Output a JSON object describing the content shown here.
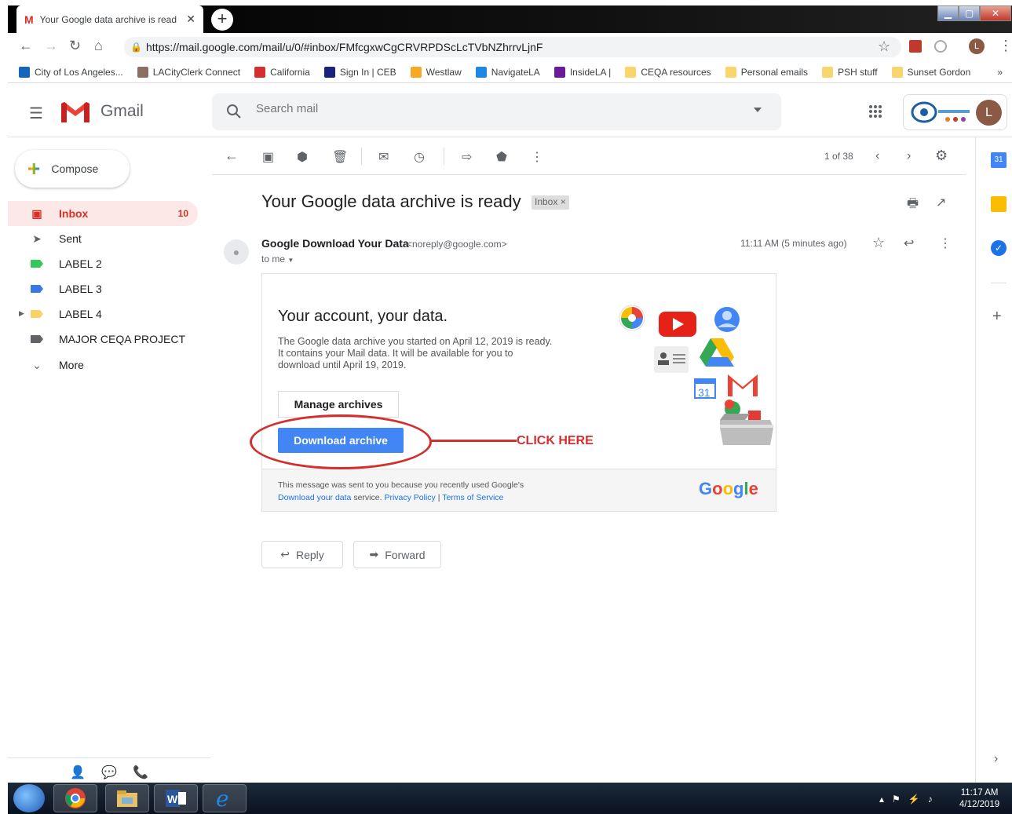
{
  "browser": {
    "tab_title": "Your Google data archive is read",
    "url": "https://mail.google.com/mail/u/0/#inbox/FMfcgxwCgCRVRPDScLcTVbNZhrrvLjnF",
    "bookmarks": [
      {
        "label": "City of Los Angeles...",
        "color": "#1565c0"
      },
      {
        "label": "LACityClerk Connect",
        "color": "#8d6e63"
      },
      {
        "label": "California",
        "color": "#d32f2f"
      },
      {
        "label": "Sign In | CEB",
        "color": "#1a237e"
      },
      {
        "label": "Westlaw",
        "color": "#f9a825"
      },
      {
        "label": "NavigateLA",
        "color": "#1e88e5"
      },
      {
        "label": "InsideLA |",
        "color": "#6a1b9a"
      },
      {
        "label": "CEQA resources",
        "color": "#f9d56e"
      },
      {
        "label": "Personal emails",
        "color": "#f9d56e"
      },
      {
        "label": "PSH stuff",
        "color": "#f9d56e"
      },
      {
        "label": "Sunset Gordon",
        "color": "#f9d56e"
      }
    ],
    "more": "»"
  },
  "gmail": {
    "app_name": "Gmail",
    "search_placeholder": "Search mail",
    "avatar_letter": "L",
    "compose_label": "Compose",
    "sidebar": [
      {
        "label": "Inbox",
        "count": "10"
      },
      {
        "label": "Sent",
        "count": ""
      },
      {
        "label": "LABEL 2",
        "count": "",
        "color": "#34c759"
      },
      {
        "label": "LABEL 3",
        "count": "",
        "color": "#3b78e7"
      },
      {
        "label": "LABEL 4",
        "count": "",
        "color": "#fad165"
      },
      {
        "label": "MAJOR CEQA PROJECT",
        "count": "",
        "color": "#5f6368"
      },
      {
        "label": "More",
        "count": ""
      }
    ],
    "pager": "1 of 38"
  },
  "message": {
    "subject": "Your Google data archive is ready",
    "badge": "Inbox",
    "badge_close": "×",
    "sender_name": "Google Download Your Data",
    "sender_email": "<noreply@google.com>",
    "to": "to me",
    "time": "11:11 AM (5 minutes ago)",
    "card_heading": "Your account, your data.",
    "card_body": "The Google data archive you started on April 12, 2019 is ready. It contains your Mail data. It will be available for you to download until April 19, 2019.",
    "manage_label": "Manage archives",
    "download_label": "Download archive",
    "annotation": "CLICK HERE",
    "footer_line1": "This message was sent to you because you recently used Google's",
    "footer_link1": "Download your data",
    "footer_mid": "service.",
    "footer_link2": "Privacy Policy",
    "footer_sep": "|",
    "footer_link3": "Terms of Service",
    "reply_label": "Reply",
    "forward_label": "Forward"
  },
  "taskbar": {
    "time": "11:17 AM",
    "date": "4/12/2019"
  }
}
